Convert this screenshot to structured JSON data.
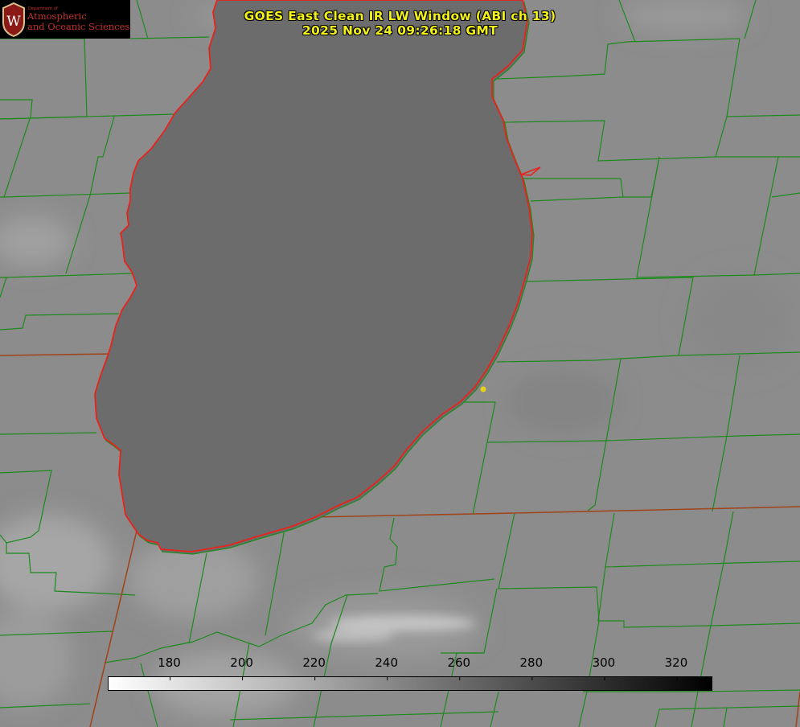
{
  "header": {
    "title_line1": "GOES East Clean IR LW Window (ABI ch 13)",
    "title_line2": "2025 Nov 24 09:26:18 GMT"
  },
  "logo": {
    "icon": "uw-crest-icon",
    "dept": "Department of",
    "line1": "Atmospheric",
    "line2": "and Oceanic Sciences",
    "color": "#c5322d"
  },
  "colorbar": {
    "ticks": [
      "180",
      "200",
      "220",
      "240",
      "260",
      "280",
      "300",
      "320"
    ],
    "min": 163,
    "max": 330,
    "gradient_from": "#ffffff",
    "gradient_to": "#000000"
  },
  "map_colors": {
    "county_lines": "#1e8a1e",
    "state_lines": "#a0461e",
    "lake_outline": "#e8231c",
    "point_marker": "#e6d21a"
  }
}
